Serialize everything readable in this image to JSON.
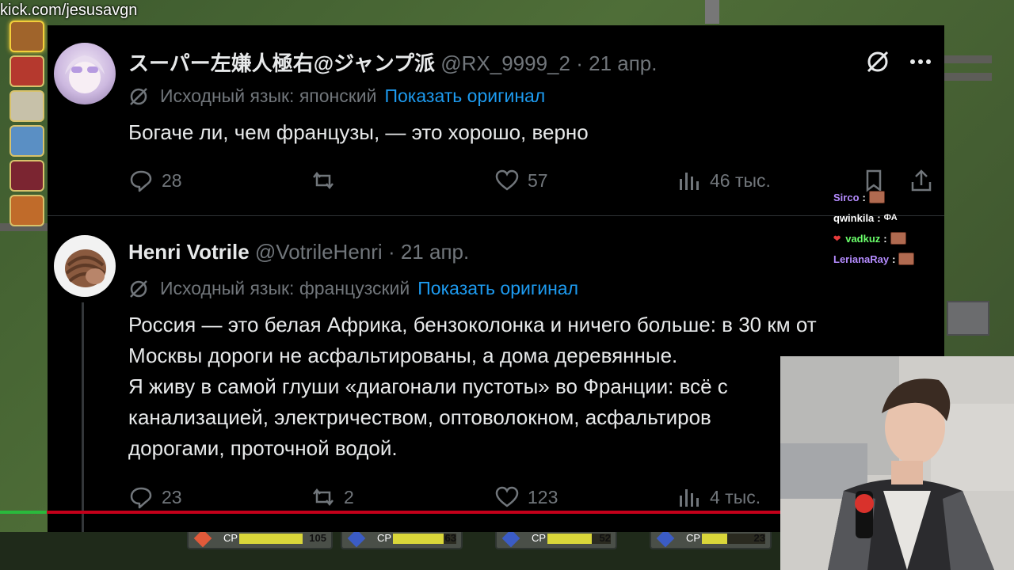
{
  "stream": {
    "url": "kick.com/jesusavgn"
  },
  "tweets": [
    {
      "author_name": "スーパー左嫌人極右@ジャンプ派",
      "handle": "@RX_9999_2",
      "date": "21 апр.",
      "source_language": "Исходный язык: японский",
      "show_original": "Показать оригинал",
      "text_lines": [
        "Богаче ли, чем французы, — это хорошо, верно"
      ],
      "replies": "28",
      "retweets": "",
      "likes": "57",
      "views": "46 тыс."
    },
    {
      "author_name": "Henri Votrile",
      "handle": "@VotrileHenri",
      "date": "21 апр.",
      "source_language": "Исходный язык: французский",
      "show_original": "Показать оригинал",
      "text_lines": [
        "Россия — это белая Африка, бензоколонка и ничего больше: в 30 км от",
        "Москвы дороги не асфальтированы, а дома деревянные.",
        "Я живу в самой глуши «диагонали пустоты» во Франции: всё с",
        "канализацией, электричеством, оптоволокном, асфальтиров",
        "дорогами, проточной водой."
      ],
      "replies": "23",
      "retweets": "2",
      "likes": "123",
      "views": "4 тыс."
    }
  ],
  "chat": [
    {
      "user": "Sirco",
      "color": "#b58cff",
      "message": ""
    },
    {
      "user": "qwinkila",
      "color": "#ffffff",
      "message": "ФА"
    },
    {
      "user": "vadkuz",
      "color": "#6bff6b",
      "message": ""
    },
    {
      "user": "LerianaRay",
      "color": "#b58cff",
      "message": ""
    }
  ],
  "hud": {
    "slots": [
      {
        "cp": "CP",
        "value": "105"
      },
      {
        "cp": "CP",
        "value": "63"
      },
      {
        "cp": "CP",
        "value": "52"
      },
      {
        "cp": "CP",
        "value": "23"
      }
    ]
  },
  "playback": {
    "progress": 0.06
  }
}
